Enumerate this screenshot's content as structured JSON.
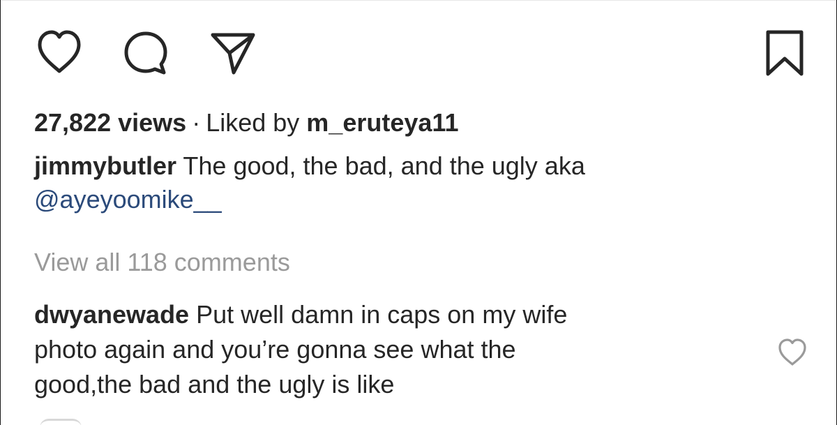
{
  "actions": {
    "like_icon": "heart-outline",
    "comment_icon": "speech-bubble",
    "share_icon": "paper-plane",
    "save_icon": "bookmark"
  },
  "post": {
    "views": "27,822 views",
    "separator": "·",
    "liked_by_prefix": "Liked by",
    "liked_by_user": "m_eruteya11",
    "author": "jimmybutler",
    "caption_text": "The good, the bad, and the ugly aka",
    "caption_mention": "@ayeyoomike__",
    "view_all_comments": "View all 118 comments"
  },
  "comment": {
    "author": "dwyanewade",
    "line1": "Put well damn in caps on my wife",
    "line2": "photo again and you’re gonna see what the",
    "line3": "good,the bad and the ugly is like",
    "like_icon": "heart-outline"
  },
  "colors": {
    "text": "#262626",
    "muted": "#9a9a9a",
    "mention": "#2b4a7a"
  }
}
